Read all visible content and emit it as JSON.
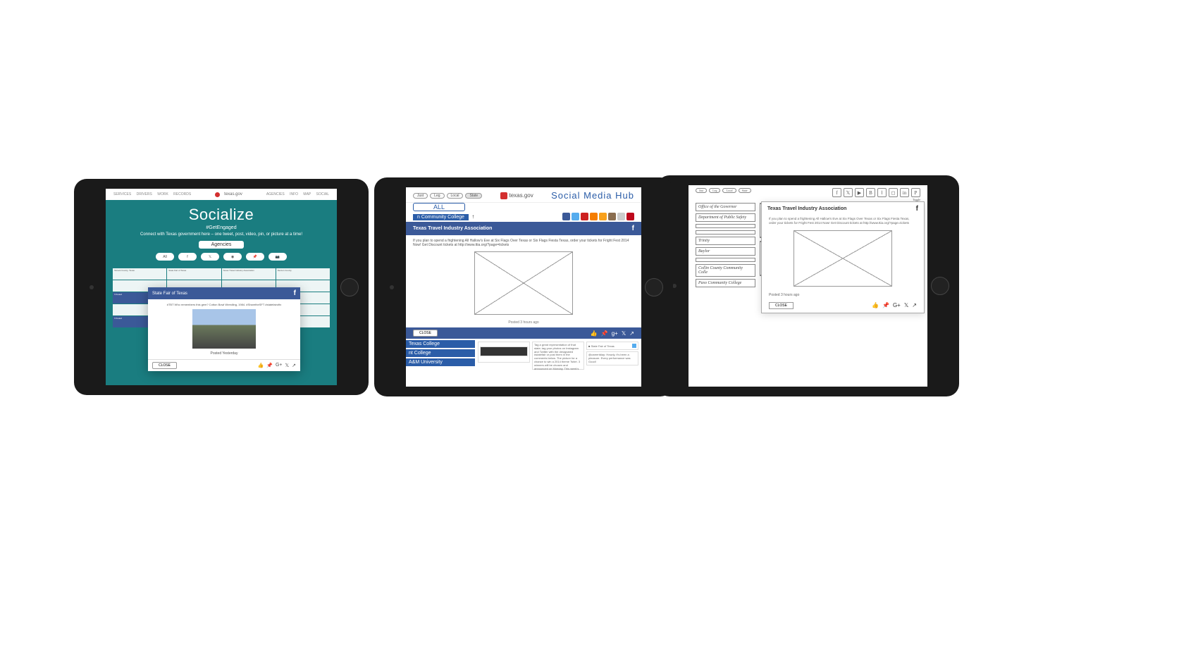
{
  "tablet1": {
    "nav": {
      "left": [
        "SERVICES",
        "DRIVERS",
        "WORK",
        "RECORDS"
      ],
      "brand": "texas.gov",
      "right": [
        "AGENCIES",
        "INFO",
        "MAP",
        "SOCIAL"
      ]
    },
    "hero": {
      "title": "Socialize",
      "hashtag": "#GetEngaged",
      "subtitle": "Connect with Texas government here – one tweet, post, video, pin, or picture at a time!",
      "agencies_label": "Agencies"
    },
    "filters": [
      "All",
      "f",
      "𝕏",
      "◉",
      "📌",
      "📷"
    ],
    "grid_cards": [
      "Tarrant County, Texas",
      "State Fair of Texas",
      "Texas Travel Industry Association",
      "Denton County",
      "",
      "",
      "",
      ""
    ],
    "modal": {
      "header": "State Fair of Texas",
      "caption": "#TBT Who remembers this gem? Cotton Bowl Wrestling, 1984. #SharetheSFT #statefairoftx",
      "posted": "Posted Yesterday",
      "close_label": "CLOSE"
    }
  },
  "tablet2": {
    "pills": [
      "Just",
      "Leg",
      "Local",
      "State"
    ],
    "brand": "texas.gov",
    "hub_title": "Social Media Hub",
    "all_label": "ALL",
    "breadcrumb": "n Community College",
    "modal": {
      "header": "Texas Travel Industry Association",
      "body": "If you plan to spend a frightening All Hallow's Eve at Six Flags Over Texas or Six Flags Fiesta Texas, order your tickets for Fright Fest 2014 Now! Get Discount tickets at http://www.ttia.org/?page=tickets",
      "posted": "Posted 3 hours ago",
      "close_label": "CLOSE"
    },
    "sidebar_items": [
      "Texas College",
      "nt College",
      "A&M University"
    ],
    "feed_card_label": "State Fair of Texas"
  },
  "tablet3": {
    "pills": [
      "Just",
      "Leg",
      "Local",
      "State"
    ],
    "toggle_label": "Toggle",
    "sidebar_items": [
      "Office of the Governor",
      "Department of Public Safety",
      "",
      "",
      "Trinity",
      "Baylor",
      "",
      "Collin County Community Colle",
      "Paso Community College"
    ],
    "modal": {
      "header": "Texas Travel Industry Association",
      "body": "If you plan to spend a frightening All Hallow's Eve at Six Flags Over Texas or Six Flags Fiesta Texas, order your tickets for Fright Fest 2014 Now! Get Discount tickets at http://www.ttia.org/?page=tickets",
      "posted": "Posted 3 hours ago",
      "close_label": "CLOSE"
    }
  }
}
